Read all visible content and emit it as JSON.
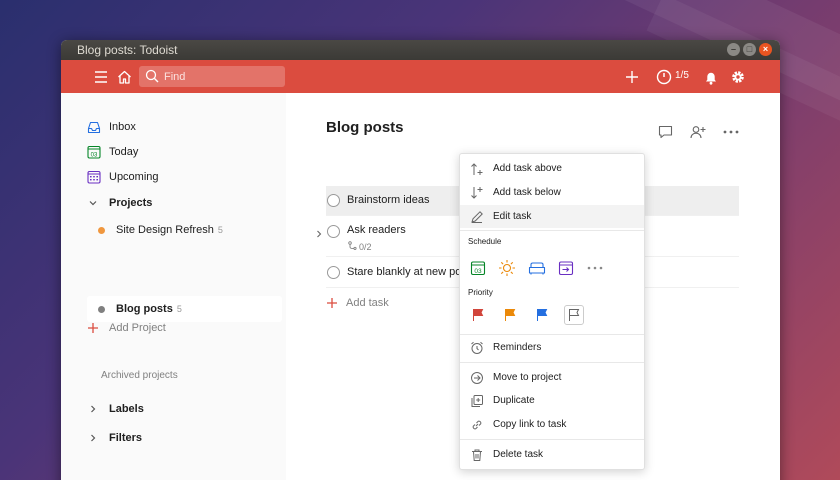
{
  "window": {
    "title": "Blog posts: Todoist"
  },
  "topbar": {
    "search_placeholder": "Find",
    "karma": "1/5"
  },
  "sidebar": {
    "inbox": "Inbox",
    "today": "Today",
    "today_day": "03",
    "upcoming": "Upcoming",
    "projects": "Projects",
    "project_list": [
      {
        "name": "Site Design Refresh",
        "count": "5",
        "color": "#f0973e"
      },
      {
        "name": "Blog posts",
        "count": "5",
        "color": "#808080"
      }
    ],
    "add_project": "Add Project",
    "archived": "Archived projects",
    "labels": "Labels",
    "filters": "Filters"
  },
  "main": {
    "title": "Blog posts",
    "tasks": [
      {
        "text": "Brainstorm ideas"
      },
      {
        "text": "Ask readers",
        "subtasks": "0/2"
      },
      {
        "text": "Stare blankly at new pos"
      }
    ],
    "add_task": "Add task"
  },
  "menu": {
    "add_above": "Add task above",
    "add_below": "Add task below",
    "edit": "Edit task",
    "schedule": "Schedule",
    "schedule_day": "03",
    "priority": "Priority",
    "reminders": "Reminders",
    "move": "Move to project",
    "duplicate": "Duplicate",
    "copy_link": "Copy link to task",
    "delete": "Delete task"
  },
  "colors": {
    "brand": "#db4c3f",
    "p1": "#d1453b",
    "p2": "#eb8909",
    "p3": "#246fe0",
    "today_green": "#058527",
    "upcoming_purple": "#692fc2"
  }
}
